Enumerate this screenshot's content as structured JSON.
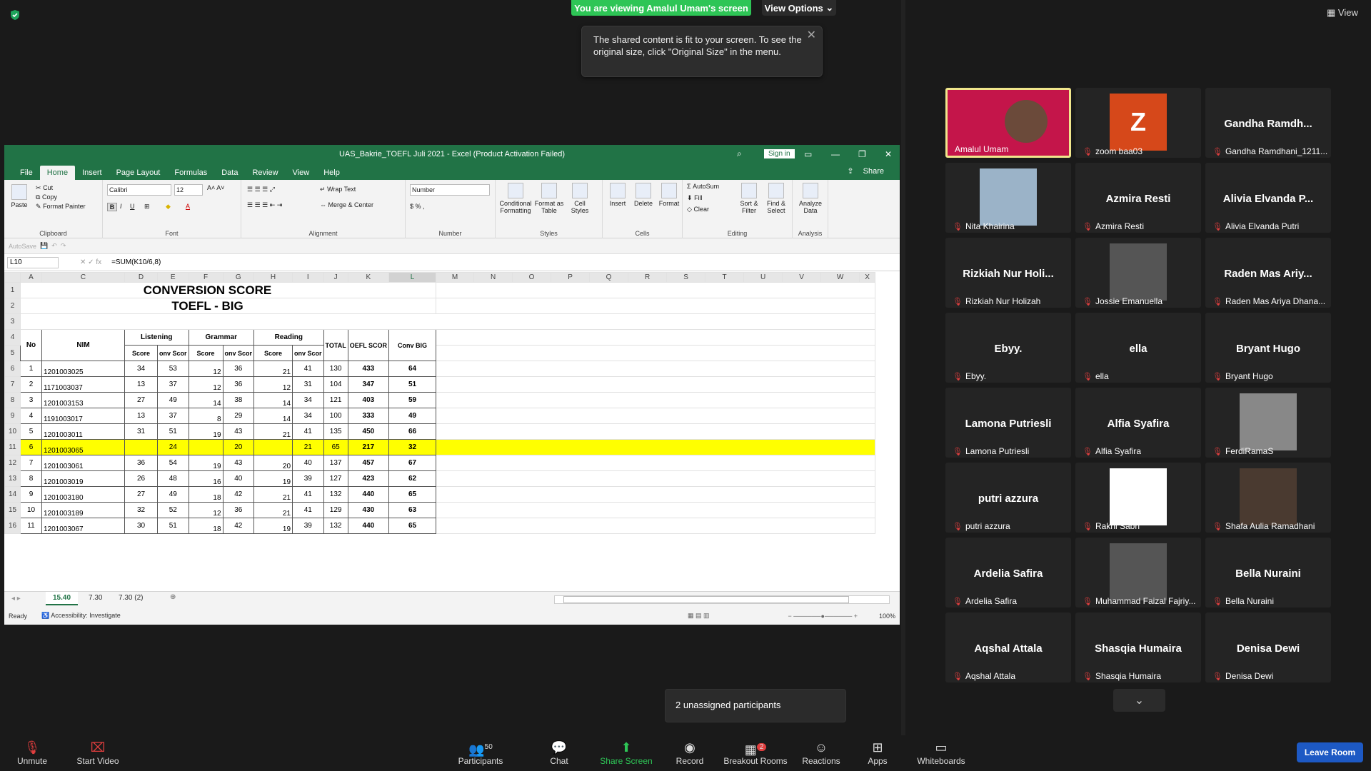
{
  "zoom": {
    "banner": "You are viewing Amalul Umam's screen",
    "view_options": "View Options",
    "tooltip": "The shared content is fit to your screen. To see the original size, click \"Original Size\" in the menu.",
    "view_button": "View",
    "unassigned": "2 unassigned participants",
    "toolbar": [
      {
        "label": "Unmute",
        "icon": "mic-muted-icon"
      },
      {
        "label": "Start Video",
        "icon": "video-off-icon"
      },
      {
        "label": "Participants",
        "icon": "participants-icon",
        "badge": "50"
      },
      {
        "label": "Chat",
        "icon": "chat-icon"
      },
      {
        "label": "Share Screen",
        "icon": "share-screen-icon"
      },
      {
        "label": "Record",
        "icon": "record-icon"
      },
      {
        "label": "Breakout Rooms",
        "icon": "breakout-icon",
        "badge": "2"
      },
      {
        "label": "Reactions",
        "icon": "reactions-icon"
      },
      {
        "label": "Apps",
        "icon": "apps-icon"
      },
      {
        "label": "Whiteboards",
        "icon": "whiteboard-icon"
      }
    ],
    "leave": "Leave Room",
    "participants": [
      {
        "big": "",
        "label": "Amalul Umam",
        "type": "video"
      },
      {
        "big": "Z",
        "label": "zoom baa03",
        "type": "avatar"
      },
      {
        "big": "Gandha Ramdh...",
        "label": "Gandha Ramdhani_1211...",
        "type": "name"
      },
      {
        "big": "",
        "label": "Nita Khairina",
        "type": "photo"
      },
      {
        "big": "Azmira Resti",
        "label": "Azmira Resti",
        "type": "name"
      },
      {
        "big": "Alivia Elvanda P...",
        "label": "Alivia Elvanda Putri",
        "type": "name"
      },
      {
        "big": "Rizkiah Nur Holi...",
        "label": "Rizkiah Nur Holizah",
        "type": "name"
      },
      {
        "big": "",
        "label": "Jossie Emanuella",
        "type": "photo"
      },
      {
        "big": "Raden Mas Ariy...",
        "label": "Raden Mas Ariya Dhana...",
        "type": "name"
      },
      {
        "big": "Ebyy.",
        "label": "Ebyy.",
        "type": "name"
      },
      {
        "big": "ella",
        "label": "ella",
        "type": "name"
      },
      {
        "big": "Bryant Hugo",
        "label": "Bryant Hugo",
        "type": "name"
      },
      {
        "big": "Lamona Putriesli",
        "label": "Lamona Putriesli",
        "type": "name"
      },
      {
        "big": "Alfia Syafira",
        "label": "Alfia Syafira",
        "type": "name"
      },
      {
        "big": "",
        "label": "FerdiRamaS",
        "type": "photo"
      },
      {
        "big": "putri azzura",
        "label": "putri azzura",
        "type": "name"
      },
      {
        "big": "",
        "label": "Rakhi Sabri",
        "type": "photo"
      },
      {
        "big": "",
        "label": "Shafa Aulia Ramadhani",
        "type": "photo"
      },
      {
        "big": "Ardelia Safira",
        "label": "Ardelia Safira",
        "type": "name"
      },
      {
        "big": "",
        "label": "Muhammad Faizal Fajriy...",
        "type": "photo"
      },
      {
        "big": "Bella Nuraini",
        "label": "Bella Nuraini",
        "type": "name"
      },
      {
        "big": "Aqshal Attala",
        "label": "Aqshal Attala",
        "type": "name"
      },
      {
        "big": "Shasqia Humaira",
        "label": "Shasqia Humaira",
        "type": "name"
      },
      {
        "big": "Denisa Dewi",
        "label": "Denisa Dewi",
        "type": "name"
      }
    ]
  },
  "excel": {
    "title": "UAS_Bakrie_TOEFL Juli 2021 - Excel (Product Activation Failed)",
    "sign_in": "Sign in",
    "share": "Share",
    "tabs": [
      "File",
      "Home",
      "Insert",
      "Page Layout",
      "Formulas",
      "Data",
      "Review",
      "View",
      "Help"
    ],
    "font": "Calibri",
    "font_size": "12",
    "number_format": "Number",
    "ribbon": {
      "paste": "Paste",
      "cut": "Cut",
      "copy": "Copy",
      "format_painter": "Format Painter",
      "clipboard": "Clipboard",
      "font": "Font",
      "wrap": "Wrap Text",
      "merge": "Merge & Center",
      "alignment": "Alignment",
      "number": "Number",
      "cond": "Conditional Formatting",
      "fmt_table": "Format as Table",
      "cell_styles": "Cell Styles",
      "styles": "Styles",
      "insert": "Insert",
      "delete": "Delete",
      "format": "Format",
      "cells": "Cells",
      "autosum": "AutoSum",
      "fill": "Fill",
      "clear": "Clear",
      "sort": "Sort & Filter",
      "find": "Find & Select",
      "editing": "Editing",
      "analyze": "Analyze Data",
      "analysis": "Analysis"
    },
    "autosave": "AutoSave",
    "name_box": "L10",
    "formula": "=SUM(K10/6,8)",
    "col_headers": [
      "",
      "A",
      "C",
      "D",
      "E",
      "F",
      "G",
      "H",
      "I",
      "J",
      "K",
      "L",
      "M",
      "N",
      "O",
      "P",
      "Q",
      "R",
      "S",
      "T",
      "U",
      "V",
      "W",
      "X"
    ],
    "heading1": "CONVERSION SCORE",
    "heading2": "TOEFL - BIG",
    "hdr": {
      "no": "No",
      "nim": "NIM",
      "listening": "Listening",
      "grammar": "Grammar",
      "reading": "Reading",
      "total": "TOTAL",
      "toefl": "OEFL SCOR",
      "conv": "Conv BIG",
      "score": "Score",
      "conv_s": "onv Scor"
    },
    "rows": [
      {
        "r": "6",
        "no": "1",
        "nim": "1201003025",
        "ls": "34",
        "lc": "53",
        "gs": "12",
        "gc": "36",
        "rs": "21",
        "rc": "41",
        "tot": "130",
        "toefl": "433",
        "big": "64"
      },
      {
        "r": "7",
        "no": "2",
        "nim": "1171003037",
        "ls": "13",
        "lc": "37",
        "gs": "12",
        "gc": "36",
        "rs": "12",
        "rc": "31",
        "tot": "104",
        "toefl": "347",
        "big": "51"
      },
      {
        "r": "8",
        "no": "3",
        "nim": "1201003153",
        "ls": "27",
        "lc": "49",
        "gs": "14",
        "gc": "38",
        "rs": "14",
        "rc": "34",
        "tot": "121",
        "toefl": "403",
        "big": "59"
      },
      {
        "r": "9",
        "no": "4",
        "nim": "1191003017",
        "ls": "13",
        "lc": "37",
        "gs": "8",
        "gc": "29",
        "rs": "14",
        "rc": "34",
        "tot": "100",
        "toefl": "333",
        "big": "49"
      },
      {
        "r": "10",
        "no": "5",
        "nim": "1201003011",
        "ls": "31",
        "lc": "51",
        "gs": "19",
        "gc": "43",
        "rs": "21",
        "rc": "41",
        "tot": "135",
        "toefl": "450",
        "big": "66"
      },
      {
        "r": "11",
        "no": "6",
        "nim": "1201003065",
        "ls": "",
        "lc": "24",
        "gs": "",
        "gc": "20",
        "rs": "",
        "rc": "21",
        "tot": "65",
        "toefl": "217",
        "big": "32"
      },
      {
        "r": "12",
        "no": "7",
        "nim": "1201003061",
        "ls": "36",
        "lc": "54",
        "gs": "19",
        "gc": "43",
        "rs": "20",
        "rc": "40",
        "tot": "137",
        "toefl": "457",
        "big": "67"
      },
      {
        "r": "13",
        "no": "8",
        "nim": "1201003019",
        "ls": "26",
        "lc": "48",
        "gs": "16",
        "gc": "40",
        "rs": "19",
        "rc": "39",
        "tot": "127",
        "toefl": "423",
        "big": "62"
      },
      {
        "r": "14",
        "no": "9",
        "nim": "1201003180",
        "ls": "27",
        "lc": "49",
        "gs": "18",
        "gc": "42",
        "rs": "21",
        "rc": "41",
        "tot": "132",
        "toefl": "440",
        "big": "65"
      },
      {
        "r": "15",
        "no": "10",
        "nim": "1201003189",
        "ls": "32",
        "lc": "52",
        "gs": "12",
        "gc": "36",
        "rs": "21",
        "rc": "41",
        "tot": "129",
        "toefl": "430",
        "big": "63"
      },
      {
        "r": "16",
        "no": "11",
        "nim": "1201003067",
        "ls": "30",
        "lc": "51",
        "gs": "18",
        "gc": "42",
        "rs": "19",
        "rc": "39",
        "tot": "132",
        "toefl": "440",
        "big": "65"
      }
    ],
    "sheet_tabs": [
      "15.40",
      "7.30",
      "7.30 (2)"
    ],
    "status": "Ready",
    "accessibility": "Accessibility: Investigate",
    "zoom_level": "100%"
  }
}
